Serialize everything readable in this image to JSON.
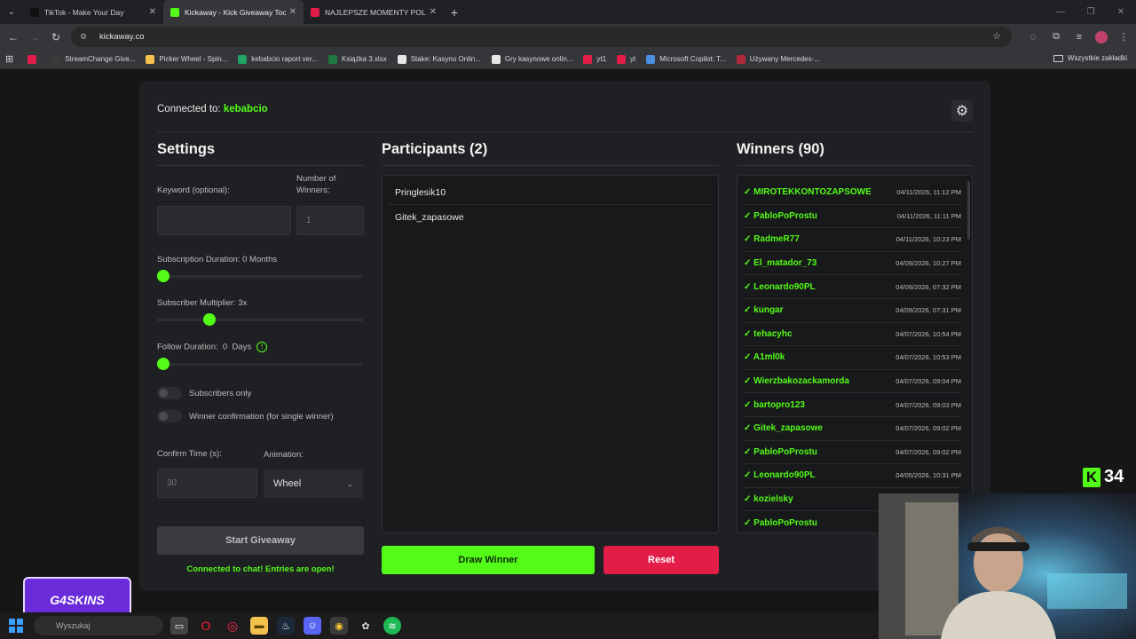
{
  "browser": {
    "tabs": [
      {
        "title": "TikTok - Make Your Day",
        "color": "#111111",
        "active": false
      },
      {
        "title": "Kickaway - Kick Giveaway Tool",
        "color": "#53fc18",
        "active": true
      },
      {
        "title": "NAJLEPSZE MOMENTY POLSKI",
        "color": "#e11d48",
        "active": false
      }
    ],
    "url": "kickaway.co",
    "bookmarks": [
      {
        "label": "",
        "color": "#e11d48"
      },
      {
        "label": "StreamChange Give...",
        "color": "#3a3a3a"
      },
      {
        "label": "Picker Wheel - Spin...",
        "color": "#f2c14e"
      },
      {
        "label": "kebabcio raport ver...",
        "color": "#1fa463"
      },
      {
        "label": "Książka 3.xlsx",
        "color": "#1f7a3f"
      },
      {
        "label": "Stake: Kasyno Onlin...",
        "color": "#e6e6e6"
      },
      {
        "label": "Gry kasynowe onlin...",
        "color": "#e6e6e6"
      },
      {
        "label": "yt1",
        "color": "#e11d48"
      },
      {
        "label": "yt",
        "color": "#e11d48"
      },
      {
        "label": "Microsoft Copilot: T...",
        "color": "#4a90e2"
      },
      {
        "label": "Używany Mercedes-...",
        "color": "#b0283a"
      }
    ],
    "all_bookmarks": "Wszystkie zakładki"
  },
  "app": {
    "connected_prefix": "Connected to:",
    "channel": "kebabcio",
    "settings": {
      "title": "Settings",
      "keyword_label": "Keyword (optional):",
      "keyword_value": "",
      "winners_label": "Number of Winners:",
      "winners_placeholder": "1",
      "sub_duration_label": "Subscription Duration: 0 Months",
      "sub_duration_value": 0,
      "multiplier_label": "Subscriber Multiplier: 3x",
      "multiplier_value": 0.24,
      "follow_label": "Follow Duration:  0  Days",
      "follow_value": 0,
      "subs_only_label": "Subscribers only",
      "confirm_label": "Winner confirmation (for single winner)",
      "confirm_time_label": "Confirm Time (s):",
      "confirm_time_placeholder": "30",
      "animation_label": "Animation:",
      "animation_value": "Wheel",
      "start_label": "Start Giveaway",
      "status": "Connected to chat! Entries are open!"
    },
    "participants": {
      "title": "Participants (2)",
      "items": [
        "Pringlesik10",
        "Gitek_zapasowe"
      ],
      "draw_label": "Draw Winner",
      "reset_label": "Reset"
    },
    "winners": {
      "title": "Winners (90)",
      "items": [
        {
          "name": "MIROTEKKONTOZAPSOWE",
          "date": "04/11/2026, 11:12 PM"
        },
        {
          "name": "PabloPoProstu",
          "date": "04/11/2026, 11:11 PM"
        },
        {
          "name": "RadmeR77",
          "date": "04/11/2026, 10:23 PM"
        },
        {
          "name": "El_matador_73",
          "date": "04/09/2026, 10:27 PM"
        },
        {
          "name": "Leonardo90PL",
          "date": "04/09/2026, 07:32 PM"
        },
        {
          "name": "kungar",
          "date": "04/09/2026, 07:31 PM"
        },
        {
          "name": "tehacyhc",
          "date": "04/07/2026, 10:54 PM"
        },
        {
          "name": "A1ml0k",
          "date": "04/07/2026, 10:53 PM"
        },
        {
          "name": "Wierzbakozackamorda",
          "date": "04/07/2026, 09:04 PM"
        },
        {
          "name": "bartopro123",
          "date": "04/07/2026, 09:03 PM"
        },
        {
          "name": "Gitek_zapasowe",
          "date": "04/07/2026, 09:02 PM"
        },
        {
          "name": "PabloPoProstu",
          "date": "04/07/2026, 09:02 PM"
        },
        {
          "name": "Leonardo90PL",
          "date": "04/05/2026, 10:31 PM"
        },
        {
          "name": "kozielsky",
          "date": ""
        },
        {
          "name": "PabloPoProstu",
          "date": ""
        }
      ]
    }
  },
  "overlay": {
    "kick_letter": "K",
    "kick_count": "34",
    "sponsor": "G4SKINS"
  },
  "taskbar": {
    "search_placeholder": "Wyszukaj"
  }
}
